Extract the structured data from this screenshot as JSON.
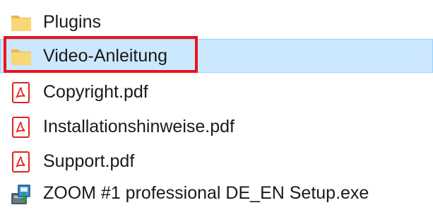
{
  "files": [
    {
      "name": "Plugins",
      "type": "folder",
      "icon": "folder-icon",
      "selected": false
    },
    {
      "name": "Video-Anleitung",
      "type": "folder",
      "icon": "folder-icon",
      "selected": true
    },
    {
      "name": "Copyright.pdf",
      "type": "pdf",
      "icon": "pdf-file-icon",
      "selected": false
    },
    {
      "name": "Installationshinweise.pdf",
      "type": "pdf",
      "icon": "pdf-file-icon",
      "selected": false
    },
    {
      "name": "Support.pdf",
      "type": "pdf",
      "icon": "pdf-file-icon",
      "selected": false
    },
    {
      "name": "ZOOM #1 professional DE_EN Setup.exe",
      "type": "exe",
      "icon": "installer-icon",
      "selected": false
    }
  ],
  "colors": {
    "selection_background": "#cce8ff",
    "selection_border": "#99d1ff",
    "highlight_box": "#e8141b",
    "folder": "#f8d775",
    "pdf_red": "#e2231a"
  }
}
